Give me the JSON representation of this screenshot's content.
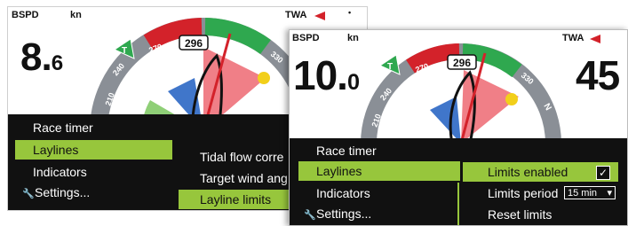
{
  "colors": {
    "accent_green": "#97c63c",
    "menu_bg": "#111111",
    "port_red": "#d3222a",
    "starboard_green": "#2fa84f",
    "dial_gray": "#8a8f96",
    "wind_blue": "#2b67c4",
    "sector_red": "#f07f87",
    "sector_green": "#8fcf77",
    "boat_dot": "#f2cf1a"
  },
  "left_screen": {
    "speed_label": "BSPD",
    "speed_unit": "kn",
    "speed_int": "8.",
    "speed_dec": "6",
    "twa_label": "TWA",
    "heading": "296",
    "dial_ticks": [
      "210",
      "240",
      "270",
      "300",
      "330",
      "N"
    ],
    "menu": {
      "items": [
        {
          "label": "Race timer",
          "selected": false
        },
        {
          "label": "Laylines",
          "selected": true
        },
        {
          "label": "Indicators",
          "selected": false
        },
        {
          "label": "Settings...",
          "selected": false,
          "icon": "wrench-icon"
        }
      ],
      "submenu": [
        {
          "label": "Tidal flow corre",
          "selected": false
        },
        {
          "label": "Target wind ang",
          "selected": false
        },
        {
          "label": "Layline limits",
          "selected": true
        }
      ]
    }
  },
  "right_screen": {
    "speed_label": "BSPD",
    "speed_unit": "kn",
    "speed_int": "10.",
    "speed_dec": "0",
    "twa_label": "TWA",
    "twa_value": "45",
    "heading": "296",
    "dial_ticks": [
      "210",
      "240",
      "270",
      "300",
      "330",
      "N"
    ],
    "menu": {
      "items": [
        {
          "label": "Race timer",
          "selected": false
        },
        {
          "label": "Laylines",
          "selected": true
        },
        {
          "label": "Indicators",
          "selected": false
        },
        {
          "label": "Settings...",
          "selected": false,
          "icon": "wrench-icon"
        }
      ],
      "submenu": {
        "limits_enabled_label": "Limits enabled",
        "limits_enabled_checked": true,
        "limits_period_label": "Limits period",
        "limits_period_value": "15 min",
        "reset_limits_label": "Reset limits"
      }
    }
  }
}
